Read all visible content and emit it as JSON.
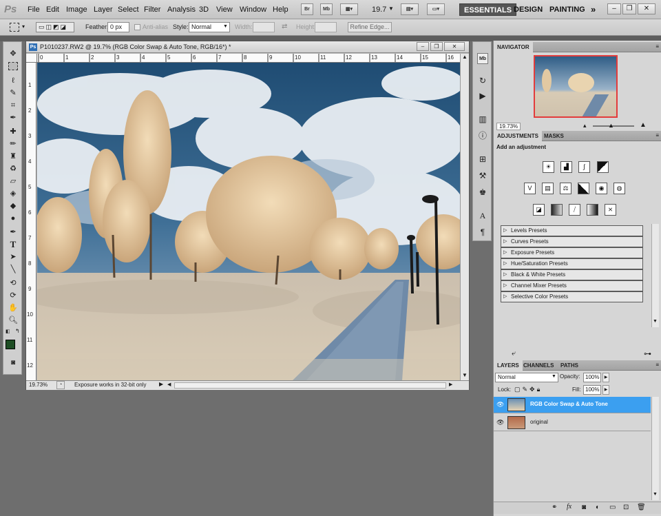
{
  "app": {
    "logo": "Ps"
  },
  "menu": [
    "File",
    "Edit",
    "Image",
    "Layer",
    "Select",
    "Filter",
    "Analysis",
    "3D",
    "View",
    "Window",
    "Help"
  ],
  "appbar": {
    "bridge": "Br",
    "minibridge": "Mb",
    "zoom": "19.7"
  },
  "workspaces": [
    "ESSENTIALS",
    "DESIGN",
    "PAINTING",
    "»"
  ],
  "options": {
    "feather_label": "Feather:",
    "feather_value": "0 px",
    "antialias_label": "Anti-alias",
    "style_label": "Style:",
    "style_value": "Normal",
    "width_label": "Width:",
    "height_label": "Height:",
    "refine_label": "Refine Edge..."
  },
  "document": {
    "title": "P1010237.RW2 @ 19.7% (RGB Color Swap & Auto Tone, RGB/16*) *",
    "ruler_h": [
      "0",
      "1",
      "2",
      "3",
      "4",
      "5",
      "6",
      "7",
      "8",
      "9",
      "10",
      "11",
      "12",
      "13",
      "14",
      "15",
      "16"
    ],
    "ruler_v": [
      "1",
      "2",
      "3",
      "4",
      "5",
      "6",
      "7",
      "8",
      "9",
      "10",
      "11",
      "12"
    ],
    "zoom": "19.73%",
    "status": "Exposure works in 32-bit only"
  },
  "navigator": {
    "tab": "NAVIGATOR",
    "zoom": "19.73%"
  },
  "adjustments": {
    "tabs": [
      "ADJUSTMENTS",
      "MASKS"
    ],
    "heading": "Add an adjustment",
    "presets": [
      "Levels Presets",
      "Curves Presets",
      "Exposure Presets",
      "Hue/Saturation Presets",
      "Black & White Presets",
      "Channel Mixer Presets",
      "Selective Color Presets"
    ]
  },
  "layers": {
    "tabs": [
      "LAYERS",
      "CHANNELS",
      "PATHS"
    ],
    "blend": "Normal",
    "opacity_label": "Opacity:",
    "opacity": "100%",
    "lock_label": "Lock:",
    "fill_label": "Fill:",
    "fill": "100%",
    "items": [
      {
        "name": "RGB Color Swap & Auto Tone",
        "selected": true
      },
      {
        "name": "original",
        "selected": false
      }
    ]
  },
  "colors": {
    "accent": "#3b9ff0",
    "foreground": "#1e4d24",
    "background": "#ffffff"
  }
}
